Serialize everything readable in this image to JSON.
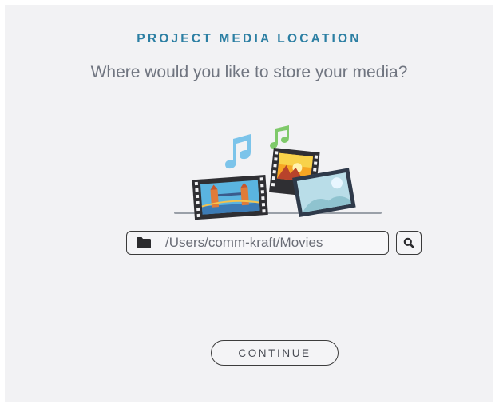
{
  "header": {
    "title": "PROJECT MEDIA LOCATION",
    "subtitle": "Where would you like to store your media?"
  },
  "location": {
    "path_value": "/Users/comm-kraft/Movies",
    "folder_icon": "folder-icon",
    "search_icon": "search-icon"
  },
  "actions": {
    "continue_label": "CONTINUE"
  },
  "colors": {
    "accent": "#2c7fa3",
    "panel_background": "#f2f2f4",
    "border": "#3a3a3a"
  }
}
